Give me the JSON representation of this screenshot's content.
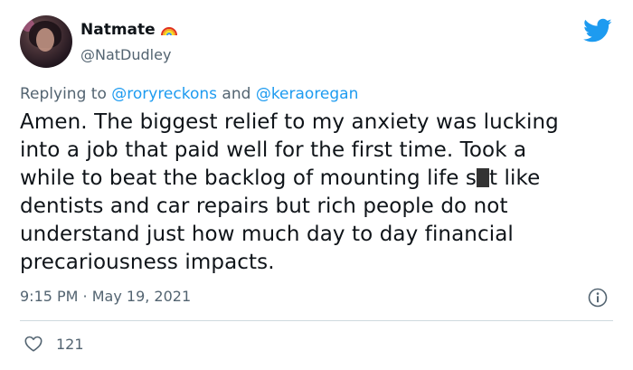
{
  "author": {
    "name": "Natmate",
    "handle": "@NatDudley",
    "badge": "rainbow-icon"
  },
  "reply": {
    "prefix": "Replying to",
    "mention1": "@roryreckons",
    "conjunction": "and",
    "mention2": "@keraoregan"
  },
  "tweet": {
    "line1": "Amen. The biggest relief to my anxiety was lucking",
    "line2": "into a job that paid well for the first time. Took a",
    "line3_a": "while to beat the backlog of mounting life s",
    "line3_b": "t like",
    "line4": "dentists and car repairs but rich people do not",
    "line5": "understand just how much day to day financial",
    "line6": "precariousness impacts."
  },
  "meta": {
    "timestamp": "9:15 PM · May 19, 2021"
  },
  "engagement": {
    "likes": "121"
  },
  "colors": {
    "brand": "#1d9bf0",
    "secondary_text": "#536471",
    "divider": "#cfd9de"
  }
}
